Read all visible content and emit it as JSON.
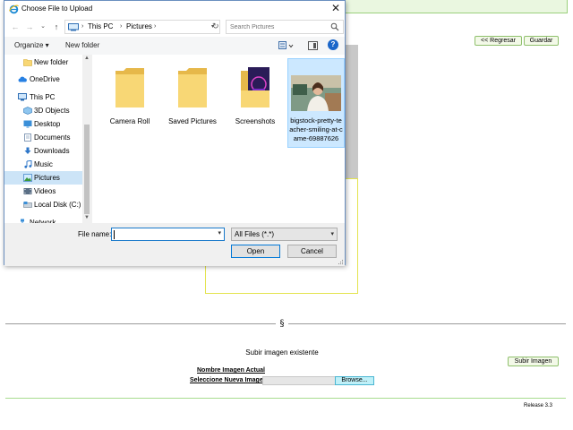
{
  "web_page": {
    "back_button": "<< Regresar",
    "save_button": "Guardar",
    "section_mark": "§",
    "section_title": "Subir imagen existente",
    "upload_button": "Subir Imagen",
    "current_image_label": "Nombre Imagen Actual",
    "select_image_label": "Seleccione Nueva Imagen",
    "browse_button": "Browse...",
    "release": "Release 3.3"
  },
  "dialog": {
    "title": "Choose File to Upload",
    "close_glyph": "✕",
    "nav": {
      "back": "←",
      "forward": "→",
      "recent": "⌄",
      "up": "↑",
      "breadcrumb": [
        "This PC",
        "Pictures"
      ],
      "chevron": "›",
      "dropdown": "▾",
      "refresh": "↻",
      "search_placeholder": "Search Pictures"
    },
    "toolbar": {
      "organize": "Organize ▾",
      "new_folder": "New folder",
      "view_dd": "▾",
      "help": "?"
    },
    "sidebar": {
      "items": [
        {
          "label": "New folder",
          "icon": "folder-icon"
        },
        {
          "label": "OneDrive",
          "icon": "cloud-icon"
        },
        {
          "label": "This PC",
          "icon": "computer-icon"
        },
        {
          "label": "3D Objects",
          "icon": "cube-icon"
        },
        {
          "label": "Desktop",
          "icon": "desktop-icon"
        },
        {
          "label": "Documents",
          "icon": "document-icon"
        },
        {
          "label": "Downloads",
          "icon": "download-icon"
        },
        {
          "label": "Music",
          "icon": "music-icon"
        },
        {
          "label": "Pictures",
          "icon": "pictures-icon"
        },
        {
          "label": "Videos",
          "icon": "video-icon"
        },
        {
          "label": "Local Disk (C:)",
          "icon": "disk-icon"
        },
        {
          "label": "Network",
          "icon": "network-icon"
        }
      ],
      "scroll_up": "▲",
      "scroll_down": "▼"
    },
    "files": [
      {
        "name": "Camera Roll",
        "type": "folder"
      },
      {
        "name": "Saved Pictures",
        "type": "folder"
      },
      {
        "name": "Screenshots",
        "type": "folder"
      },
      {
        "name": "bigstock-pretty-teacher-smiling-at-came-69887626",
        "type": "image"
      }
    ],
    "bottom": {
      "file_name_label": "File name:",
      "file_name_value": "",
      "filter": "All Files (*.*)",
      "open": "Open",
      "cancel": "Cancel"
    },
    "colors": {
      "selection": "#cce4f7",
      "accent": "#0078d7",
      "folder": "#f8d775"
    }
  }
}
